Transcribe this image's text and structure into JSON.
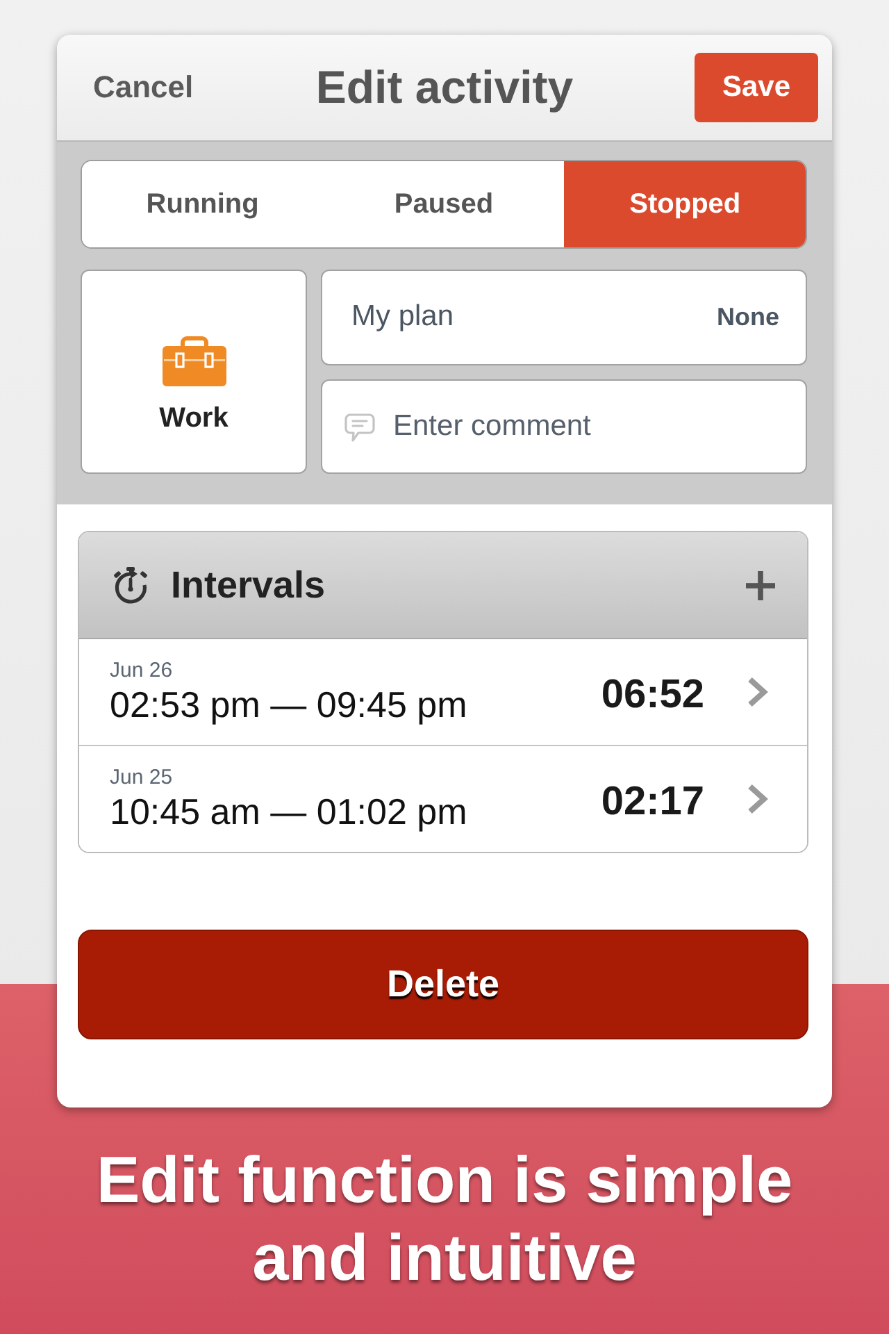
{
  "header": {
    "cancel": "Cancel",
    "title": "Edit activity",
    "save": "Save"
  },
  "status_tabs": [
    {
      "label": "Running",
      "selected": false
    },
    {
      "label": "Paused",
      "selected": false
    },
    {
      "label": "Stopped",
      "selected": true
    }
  ],
  "category": {
    "label": "Work"
  },
  "plan": {
    "label": "My plan",
    "value": "None"
  },
  "comment": {
    "placeholder": "Enter comment"
  },
  "intervals": {
    "title": "Intervals",
    "rows": [
      {
        "date": "Jun 26",
        "range": "02:53 pm — 09:45 pm",
        "duration": "06:52"
      },
      {
        "date": "Jun 25",
        "range": "10:45 am — 01:02 pm",
        "duration": "02:17"
      }
    ]
  },
  "delete_button": "Delete",
  "caption": "Edit function is simple and intuitive"
}
